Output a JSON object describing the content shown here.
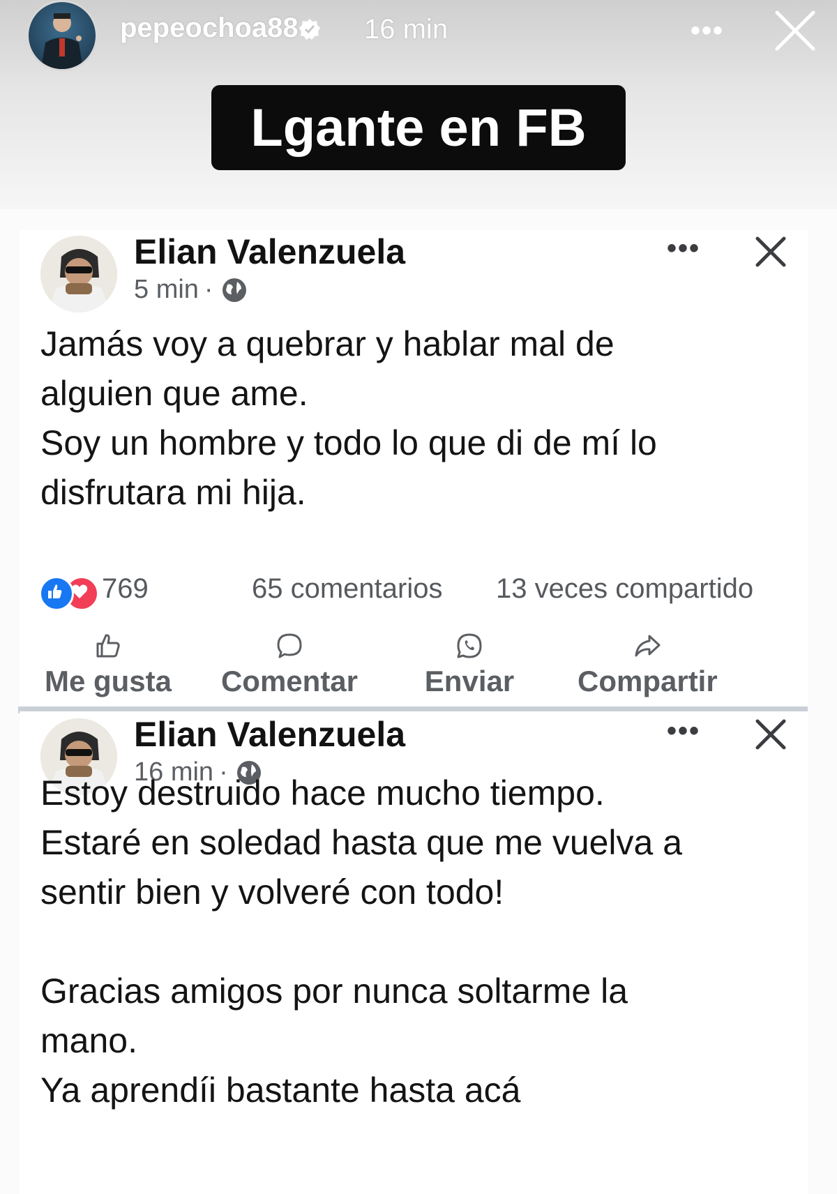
{
  "story": {
    "username": "pepeochoa88",
    "time": "16 min",
    "more": "•••",
    "caption": "Lgante en FB"
  },
  "colors": {
    "caption_bg": "#0c0c0c",
    "like_blue": "#1877f2",
    "love_red": "#f33e58",
    "muted_text": "#5b5e62",
    "divider": "#c9cfd6"
  },
  "posts": [
    {
      "author": "Elian Valenzuela",
      "time": "5 min",
      "sep": "·",
      "more": "•••",
      "lines": [
        "Jamás voy a quebrar y hablar mal de",
        "alguien que ame.",
        "Soy un hombre y todo lo que di de mí lo",
        "disfrutara mi hija."
      ],
      "reactions": "769",
      "comments": "65 comentarios",
      "shares": "13 veces compartido",
      "actions": [
        "Me gusta",
        "Comentar",
        "Enviar",
        "Compartir"
      ]
    },
    {
      "author": "Elian Valenzuela",
      "time": "16 min",
      "sep": "·",
      "more": "•••",
      "lines": [
        "Estoy destruido hace mucho tiempo.",
        "Estaré en soledad hasta que me vuelva a",
        "sentir bien y volveré con todo!",
        "",
        "Gracias amigos por nunca soltarme la",
        "mano.",
        "Ya aprendíi bastante hasta acá"
      ]
    }
  ],
  "icons": {
    "story_close": "close-icon",
    "verified": "verified-badge-icon",
    "globe": "globe-icon",
    "like": "thumbs-up-icon",
    "comment": "comment-bubble-icon",
    "send": "whatsapp-icon",
    "share": "share-arrow-icon"
  }
}
